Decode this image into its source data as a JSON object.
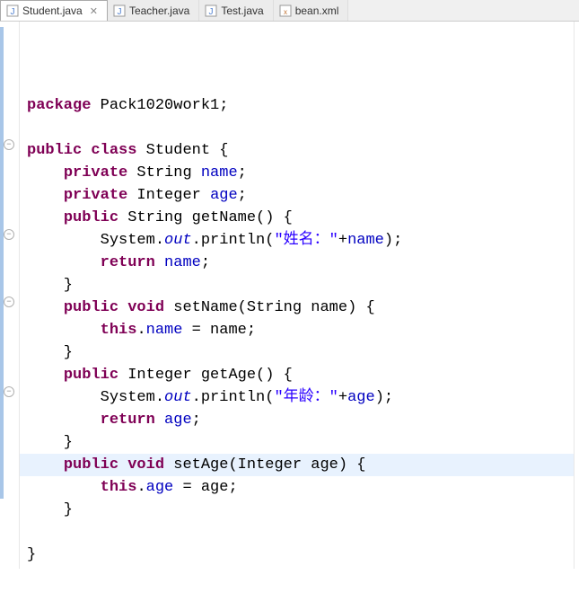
{
  "tabs": [
    {
      "label": "Student.java",
      "active": true,
      "icon": "java",
      "closable": true
    },
    {
      "label": "Teacher.java",
      "active": false,
      "icon": "java",
      "closable": false
    },
    {
      "label": "Test.java",
      "active": false,
      "icon": "java",
      "closable": false
    },
    {
      "label": "bean.xml",
      "active": false,
      "icon": "xml",
      "closable": false
    }
  ],
  "code": {
    "l1_pkg": "package",
    "l1_name": " Pack1020work1;",
    "l3_pub": "public",
    "l3_cls": "class",
    "l3_name": " Student {",
    "l4_priv": "private",
    "l4_type": " String ",
    "l4_field": "name",
    "l4_end": ";",
    "l5_priv": "private",
    "l5_type": " Integer ",
    "l5_field": "age",
    "l5_end": ";",
    "l6_pub": "public",
    "l6_sig": " String getName() {",
    "l7_a": "        System.",
    "l7_out": "out",
    "l7_b": ".println(",
    "l7_str": "\"姓名：\"",
    "l7_c": "+",
    "l7_field": "name",
    "l7_d": ");",
    "l8_ret": "return",
    "l8_sp": " ",
    "l8_field": "name",
    "l8_end": ";",
    "l9": "    }",
    "l10_pub": "public",
    "l10_void": "void",
    "l10_sig": " setName(String name) {",
    "l11_this": "this",
    "l11_a": ".",
    "l11_field": "name",
    "l11_b": " = name;",
    "l12": "    }",
    "l13_pub": "public",
    "l13_sig": " Integer getAge() {",
    "l14_a": "        System.",
    "l14_out": "out",
    "l14_b": ".println(",
    "l14_str": "\"年龄：\"",
    "l14_c": "+",
    "l14_field": "age",
    "l14_d": ");",
    "l15_ret": "return",
    "l15_sp": " ",
    "l15_field": "age",
    "l15_end": ";",
    "l16": "    }",
    "l17_pub": "public",
    "l17_void": "void",
    "l17_sig": " setAge(Integer age) {",
    "l18_this": "this",
    "l18_a": ".",
    "l18_field": "age",
    "l18_b": " = age;",
    "l19": "    }",
    "l20": "    ",
    "l21": "}"
  }
}
